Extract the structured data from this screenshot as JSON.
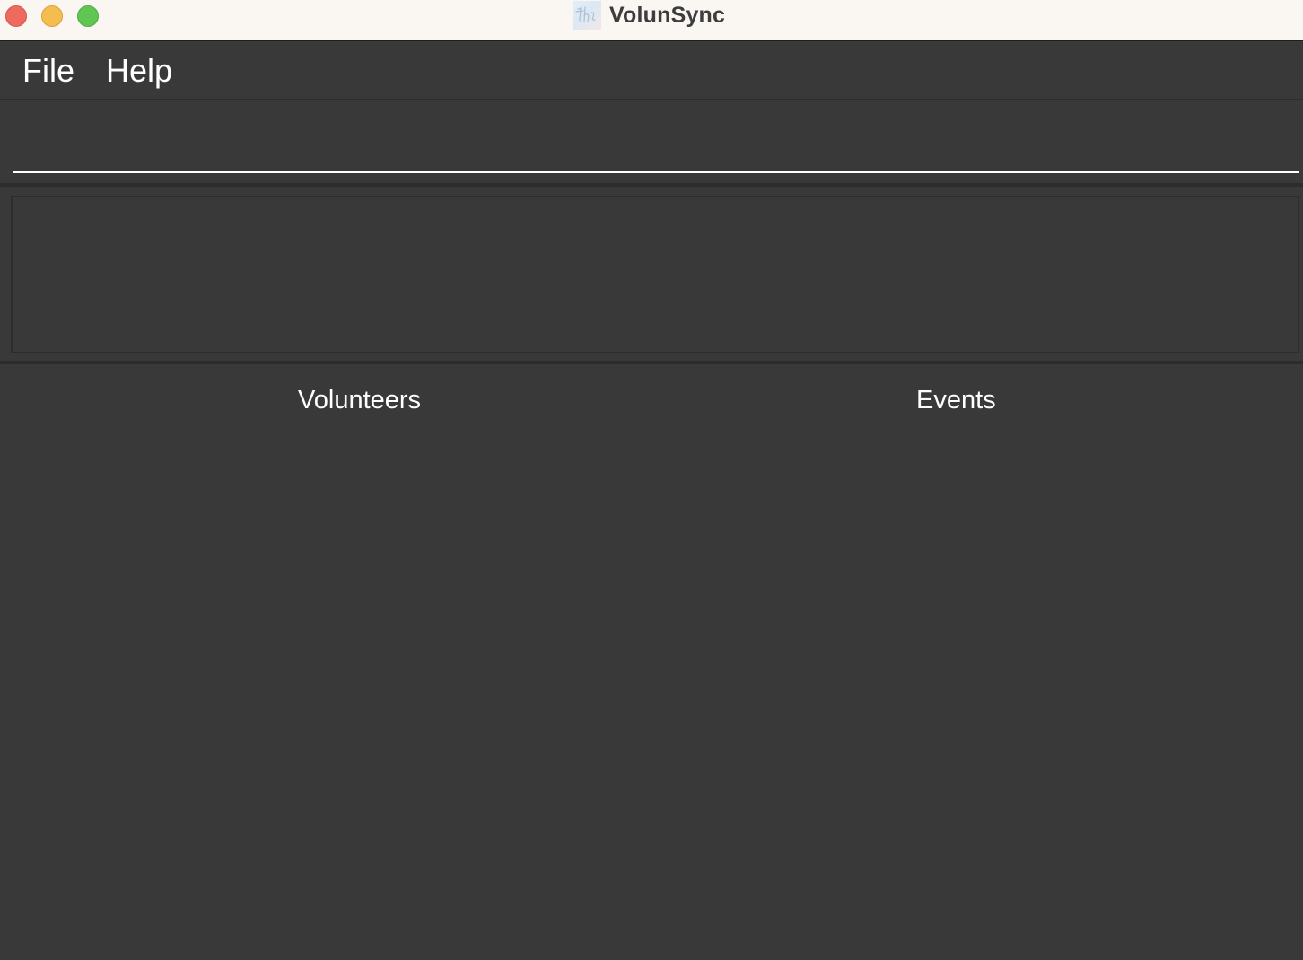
{
  "window": {
    "title": "VolunSync",
    "app_icon_name": "volunsync-logo-icon",
    "traffic_lights": {
      "close_color": "#ee6a5f",
      "minimize_color": "#f5bd4f",
      "zoom_color": "#61c554"
    }
  },
  "menubar": {
    "items": [
      {
        "label": "File"
      },
      {
        "label": "Help"
      }
    ]
  },
  "command_box": {
    "value": "",
    "placeholder": ""
  },
  "result_display": {
    "text": ""
  },
  "lists": {
    "volunteers": {
      "heading": "Volunteers",
      "items": []
    },
    "events": {
      "heading": "Events",
      "items": []
    }
  },
  "theme": {
    "background": "#393939",
    "titlebar_background": "#faf6f1",
    "text_color": "#ffffff"
  }
}
